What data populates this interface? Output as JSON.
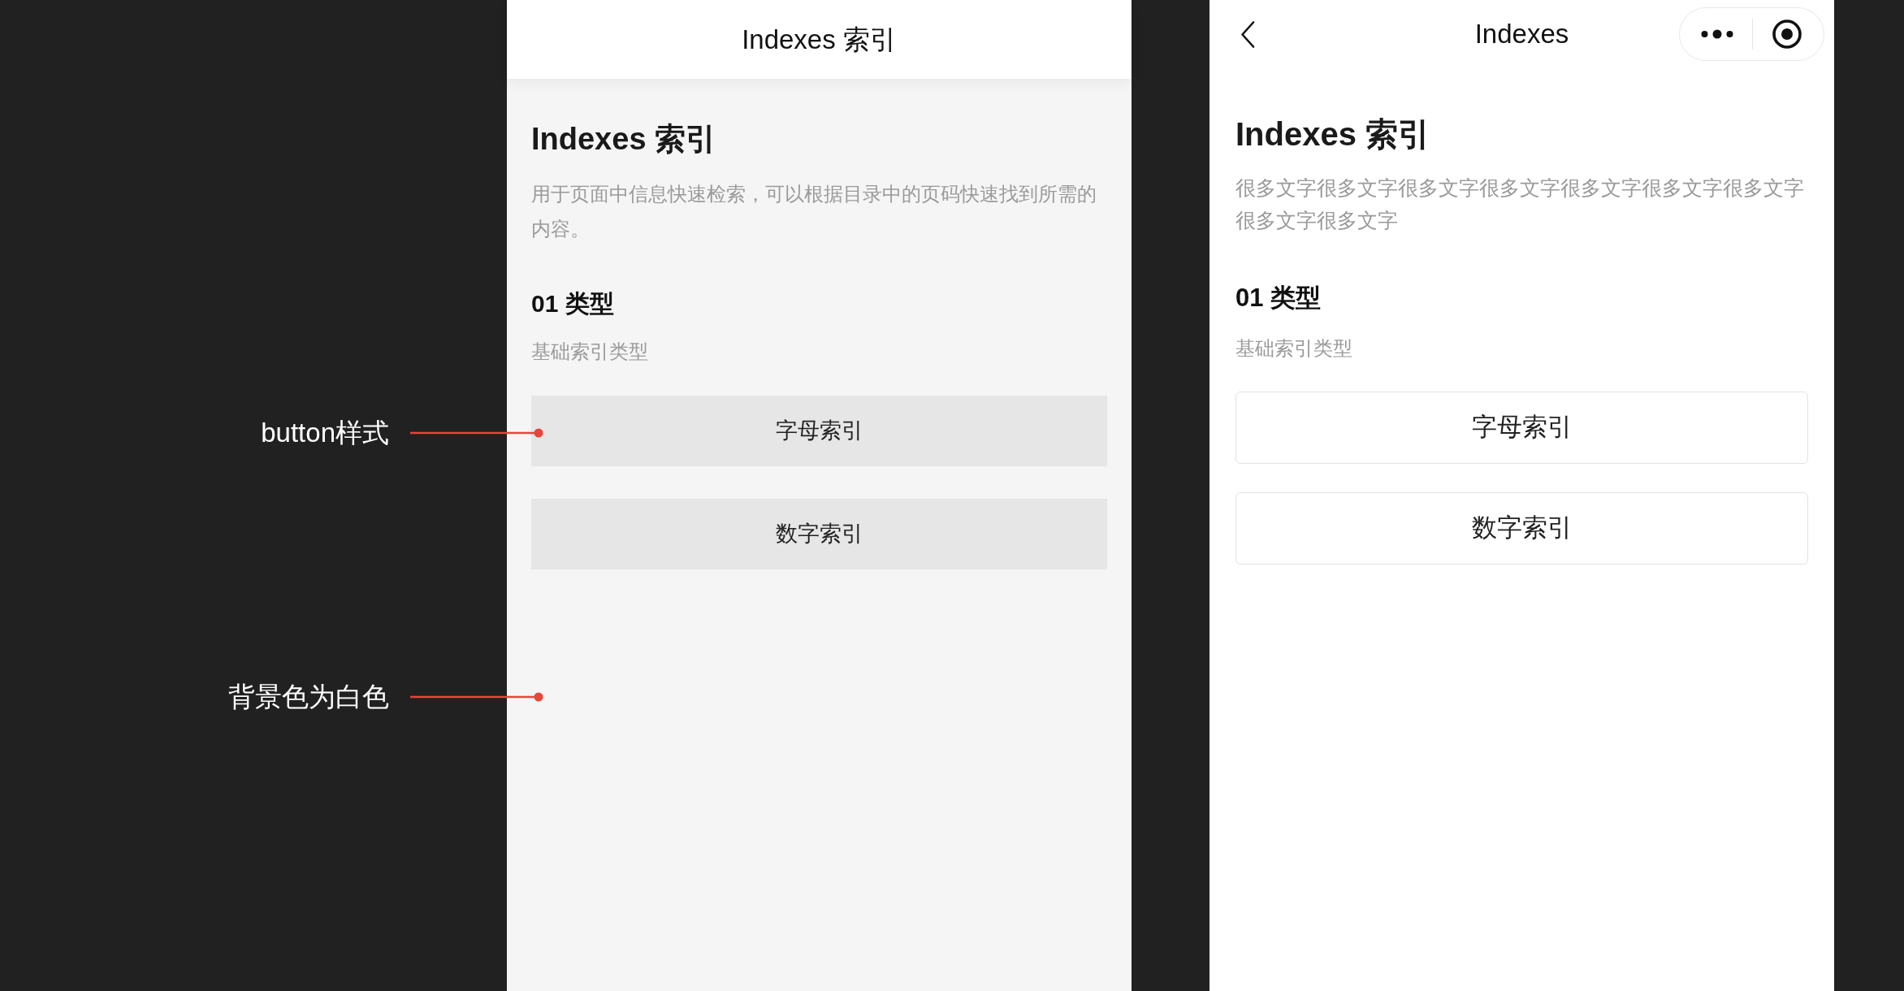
{
  "screens": [
    {
      "kind": "plain",
      "nav": {
        "title": "Indexes 索引"
      },
      "heading": "Indexes 索引",
      "description": "用于页面中信息快速检索，可以根据目录中的页码快速找到所需的内容。",
      "section": {
        "title": "01 类型",
        "subtitle": "基础索引类型"
      },
      "buttons": [
        "字母索引",
        "数字索引"
      ]
    },
    {
      "kind": "miniprogram",
      "nav": {
        "title": "Indexes"
      },
      "heading": "Indexes 索引",
      "description": "很多文字很多文字很多文字很多文字很多文字很多文字很多文字很多文字很多文字",
      "section": {
        "title": "01 类型",
        "subtitle": "基础索引类型"
      },
      "buttons": [
        "字母索引",
        "数字索引"
      ]
    }
  ],
  "annotations": [
    {
      "label": "button样式"
    },
    {
      "label": "背景色为白色"
    }
  ]
}
